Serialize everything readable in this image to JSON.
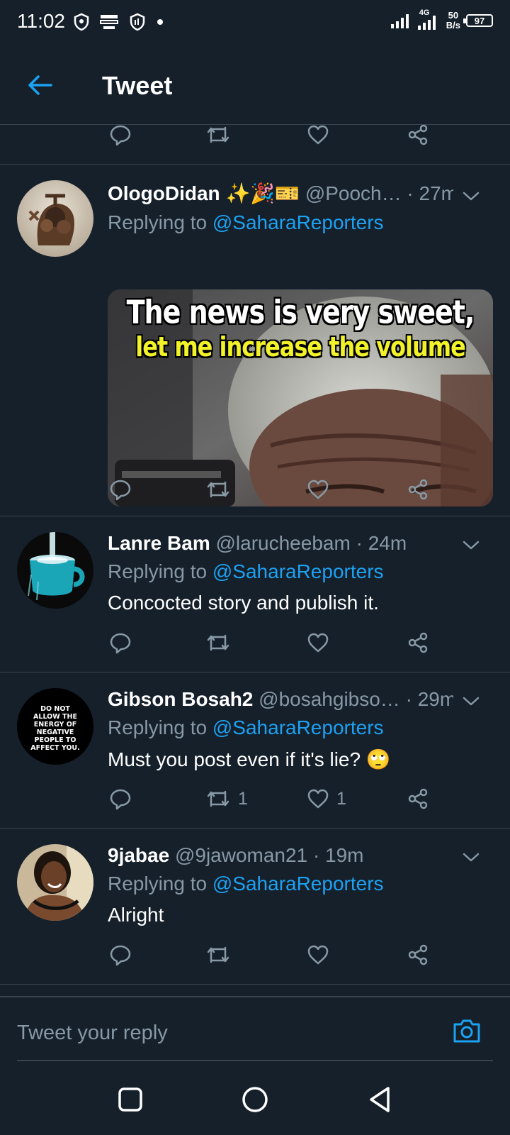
{
  "status_bar": {
    "time": "11:02",
    "network": "4G",
    "speed_value": "50",
    "speed_unit": "B/s",
    "battery": "97"
  },
  "header": {
    "title": "Tweet"
  },
  "colors": {
    "background": "#15202b",
    "accent": "#1da1f2",
    "muted": "#8899a6",
    "divider": "#38444d"
  },
  "tweets": [
    {
      "name": "OlogoDidan",
      "name_emoji": "✨🎉🎫",
      "handle": "@Pooch…",
      "time": "· 27m",
      "replying_prefix": "Replying to",
      "replying_to": "@SaharaReporters",
      "media_caption_line1": "The news is very sweet,",
      "media_caption_line2": "let me increase the volume"
    },
    {
      "name": "Lanre Bam",
      "handle": "@larucheebam",
      "time": "· 24m",
      "replying_prefix": "Replying to",
      "replying_to": "@SaharaReporters",
      "text": "Concocted story and  publish it."
    },
    {
      "name": "Gibson Bosah2",
      "handle": "@bosahgibso…",
      "time": "· 29m",
      "replying_prefix": "Replying to",
      "replying_to": "@SaharaReporters",
      "text": "Must you post even if it's lie? 🙄",
      "avatar_text": "DO NOT ALLOW THE ENERGY OF NEGATIVE PEOPLE TO AFFECT YOU.",
      "retweet_count": "1",
      "like_count": "1"
    },
    {
      "name": "9jabae",
      "handle": "@9jawoman21",
      "time": "· 19m",
      "replying_prefix": "Replying to",
      "replying_to": "@SaharaReporters",
      "text": "Alright"
    }
  ],
  "compose": {
    "placeholder": "Tweet your reply"
  }
}
